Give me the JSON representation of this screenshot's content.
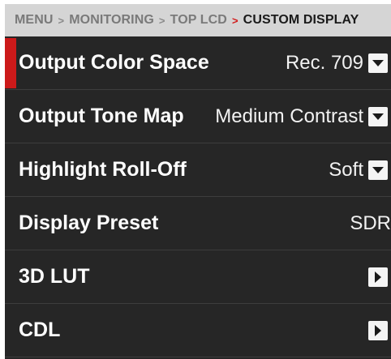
{
  "breadcrumb": {
    "items": [
      "MENU",
      "MONITORING",
      "TOP LCD",
      "CUSTOM DISPLAY"
    ],
    "separator": ">"
  },
  "menu": {
    "items": [
      {
        "label": "Output Color Space",
        "value": "Rec. 709",
        "control": "chevron-down-icon",
        "selected": true
      },
      {
        "label": "Output Tone Map",
        "value": "Medium Contrast",
        "control": "chevron-down-icon"
      },
      {
        "label": "Highlight Roll-Off",
        "value": "Soft",
        "control": "chevron-down-icon"
      },
      {
        "label": "Display Preset",
        "value": "SDR"
      },
      {
        "label": "3D LUT",
        "control": "chevron-right-icon"
      },
      {
        "label": "CDL",
        "control": "chevron-right-icon"
      }
    ]
  },
  "colors": {
    "breadcrumb_bg": "#d5d5d5",
    "menu_bg": "#262626",
    "accent_red": "#cc1a1a",
    "text": "#ffffff"
  }
}
